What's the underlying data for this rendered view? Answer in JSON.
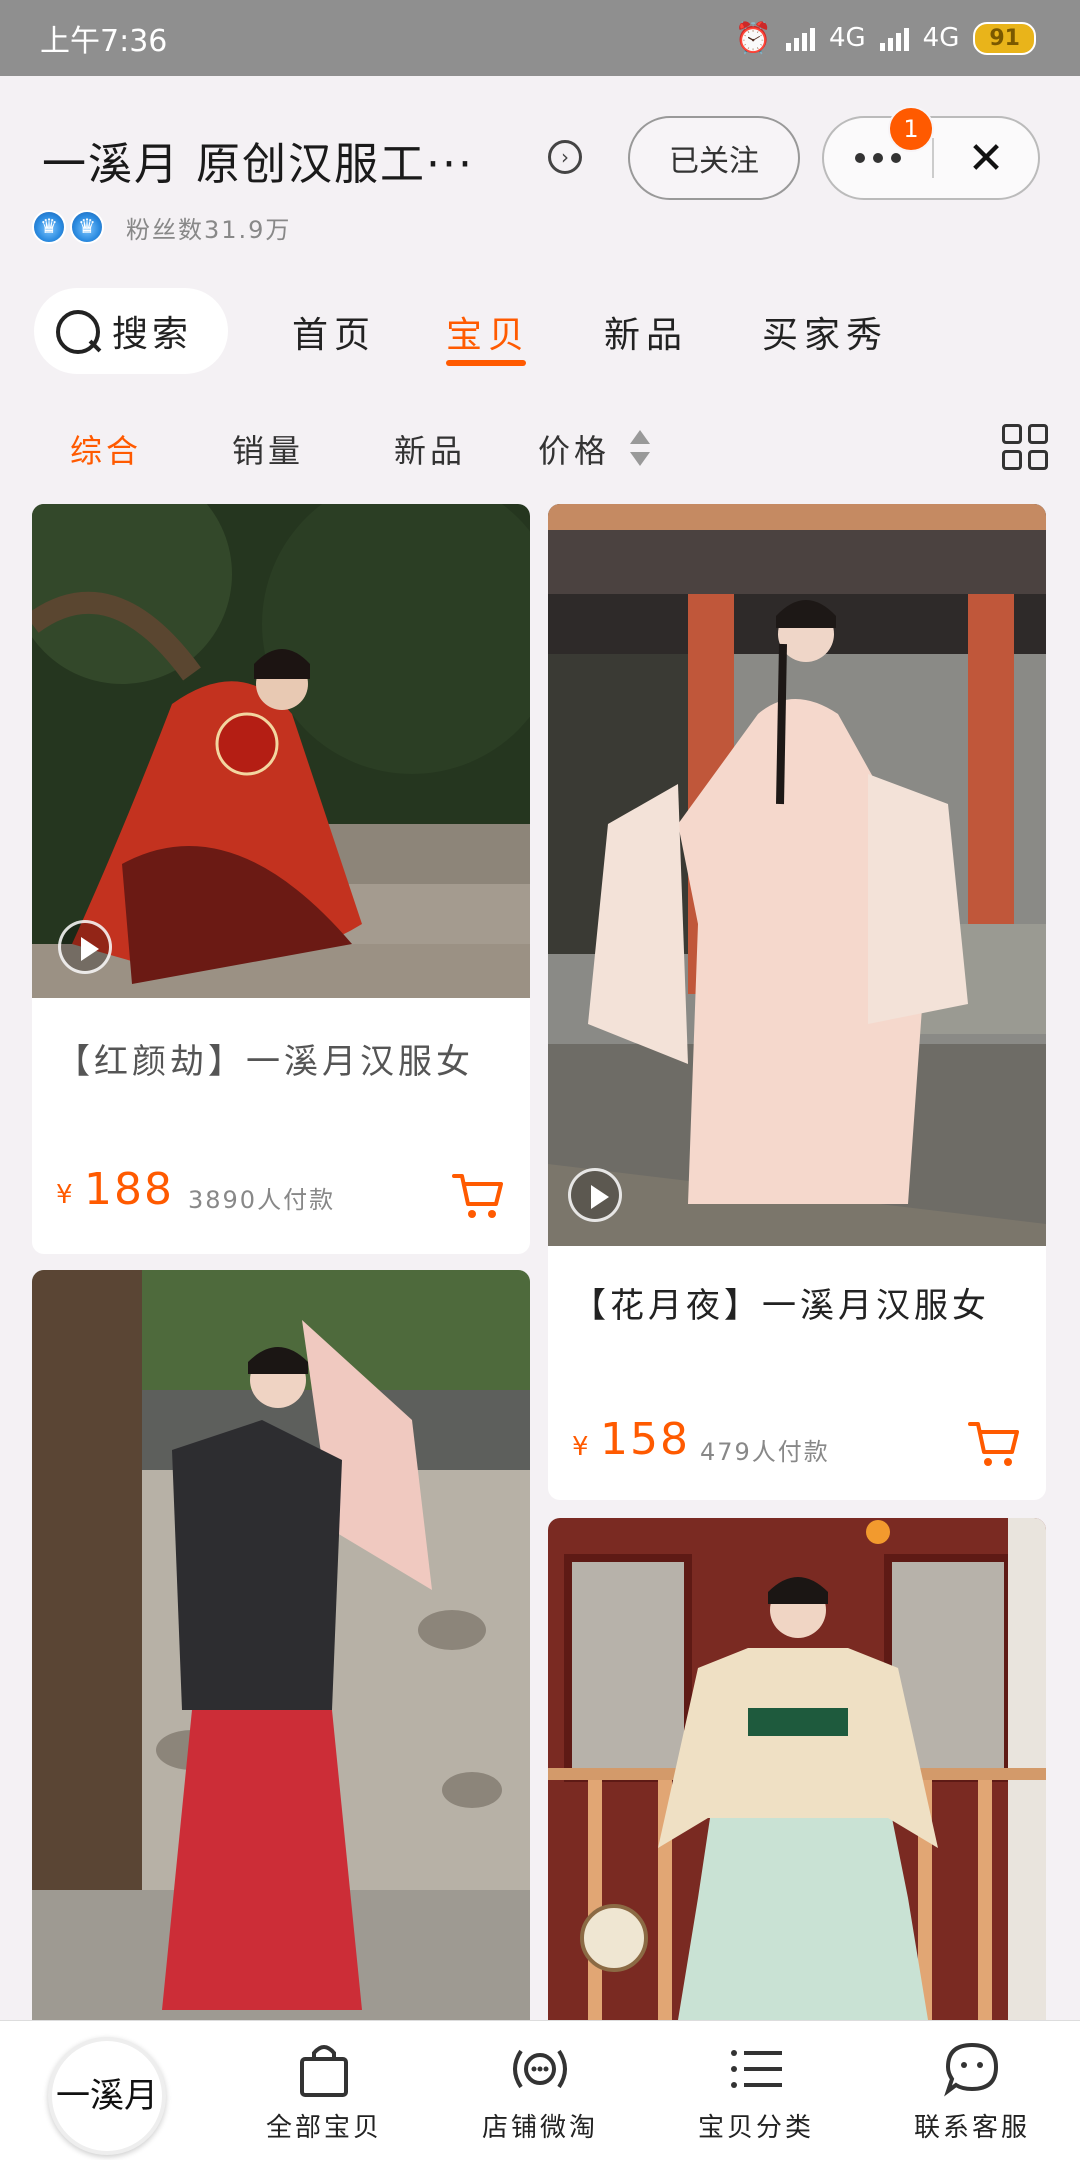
{
  "status": {
    "time": "上午7:36",
    "net1": "4G",
    "net2": "4G",
    "battery": "91"
  },
  "header": {
    "shop_name": "一溪月 原创汉服工···",
    "follow_label": "已关注",
    "notify_count": "1",
    "fans_text": "粉丝数31.9万"
  },
  "nav": {
    "search_label": "搜索",
    "tabs": [
      {
        "label": "首页"
      },
      {
        "label": "宝贝"
      },
      {
        "label": "新品"
      },
      {
        "label": "买家秀"
      }
    ],
    "active_tab": "宝贝"
  },
  "sort": {
    "items": [
      {
        "label": "综合"
      },
      {
        "label": "销量"
      },
      {
        "label": "新品"
      },
      {
        "label": "价格"
      }
    ],
    "active": "综合"
  },
  "products": [
    {
      "title": "【红颜劫】一溪月汉服女",
      "currency": "¥",
      "price": "188",
      "paid": "3890人付款",
      "has_video": true
    },
    {
      "title": "【花月夜】一溪月汉服女",
      "currency": "¥",
      "price": "158",
      "paid": "479人付款",
      "has_video": true
    },
    {
      "title": "",
      "has_video": false
    },
    {
      "title": "",
      "has_video": false
    }
  ],
  "bottom": {
    "logo_text": "一溪月",
    "items": [
      {
        "label": "全部宝贝",
        "icon": "shopping-bag-icon"
      },
      {
        "label": "店铺微淘",
        "icon": "broadcast-icon"
      },
      {
        "label": "宝贝分类",
        "icon": "list-icon"
      },
      {
        "label": "联系客服",
        "icon": "chat-bubble-icon"
      }
    ]
  },
  "colors": {
    "accent": "#ff5a00",
    "background": "#f4f1f4"
  }
}
